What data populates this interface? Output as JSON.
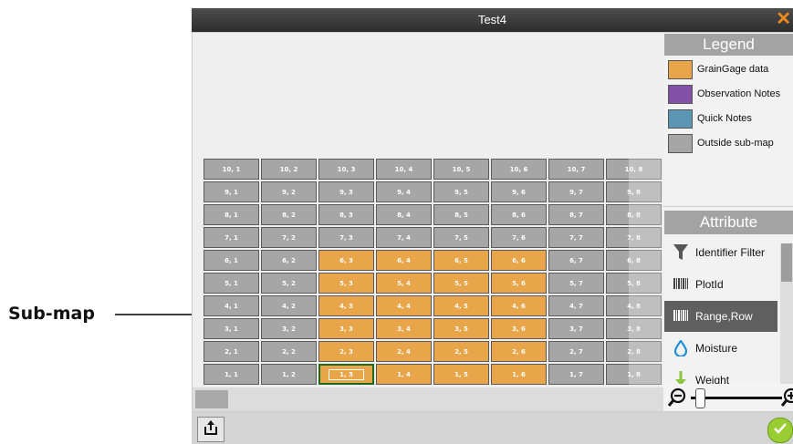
{
  "annotation": {
    "label": "Sub-map"
  },
  "window": {
    "title": "Test4",
    "close_glyph": "✕"
  },
  "legend": {
    "title": "Legend",
    "items": [
      {
        "label": "GrainGage data",
        "color": "#e8a54a"
      },
      {
        "label": "Observation Notes",
        "color": "#8352a8"
      },
      {
        "label": "Quick Notes",
        "color": "#5b96b4"
      },
      {
        "label": "Outside sub-map",
        "color": "#a6a6a6"
      }
    ]
  },
  "attribute": {
    "title": "Attribute",
    "items": [
      {
        "label": "Identifier Filter",
        "icon": "filter-icon",
        "active": false
      },
      {
        "label": "PlotId",
        "icon": "barcode-icon",
        "active": false
      },
      {
        "label": "Range,Row",
        "icon": "barcode-icon",
        "active": true
      },
      {
        "label": "Moisture",
        "icon": "water-drop-icon",
        "active": false
      },
      {
        "label": "Weight",
        "icon": "weight-down-arrow-icon",
        "active": false
      }
    ]
  },
  "grid": {
    "rows": [
      {
        "row": 10,
        "cells": [
          "10, 1",
          "10, 2",
          "10, 3",
          "10, 4",
          "10, 5",
          "10, 6",
          "10, 7",
          "10, 8"
        ],
        "orange": []
      },
      {
        "row": 9,
        "cells": [
          "9, 1",
          "9, 2",
          "9, 3",
          "9, 4",
          "9, 5",
          "9, 6",
          "9, 7",
          "9, 8"
        ],
        "orange": []
      },
      {
        "row": 8,
        "cells": [
          "8, 1",
          "8, 2",
          "8, 3",
          "8, 4",
          "8, 5",
          "8, 6",
          "8, 7",
          "8, 8"
        ],
        "orange": []
      },
      {
        "row": 7,
        "cells": [
          "7, 1",
          "7, 2",
          "7, 3",
          "7, 4",
          "7, 5",
          "7, 6",
          "7, 7",
          "7, 8"
        ],
        "orange": []
      },
      {
        "row": 6,
        "cells": [
          "6, 1",
          "6, 2",
          "6, 3",
          "6, 4",
          "6, 5",
          "6, 6",
          "6, 7",
          "6, 8"
        ],
        "orange": [
          2,
          3,
          4,
          5
        ]
      },
      {
        "row": 5,
        "cells": [
          "5, 1",
          "5, 2",
          "5, 3",
          "5, 4",
          "5, 5",
          "5, 6",
          "5, 7",
          "5, 8"
        ],
        "orange": [
          2,
          3,
          4,
          5
        ]
      },
      {
        "row": 4,
        "cells": [
          "4, 1",
          "4, 2",
          "4, 3",
          "4, 4",
          "4, 5",
          "4, 6",
          "4, 7",
          "4, 8"
        ],
        "orange": [
          2,
          3,
          4,
          5
        ]
      },
      {
        "row": 3,
        "cells": [
          "3, 1",
          "3, 2",
          "3, 3",
          "3, 4",
          "3, 5",
          "3, 6",
          "3, 7",
          "3, 8"
        ],
        "orange": [
          2,
          3,
          4,
          5
        ]
      },
      {
        "row": 2,
        "cells": [
          "2, 1",
          "2, 2",
          "2, 3",
          "2, 4",
          "2, 5",
          "2, 6",
          "2, 7",
          "2, 8"
        ],
        "orange": [
          2,
          3,
          4,
          5
        ]
      },
      {
        "row": 1,
        "cells": [
          "1, 1",
          "1, 2",
          "1, 3",
          "1, 4",
          "1, 5",
          "1, 6",
          "1, 7",
          "1, 8"
        ],
        "orange": [
          2,
          3,
          4,
          5
        ]
      }
    ],
    "selected": "1, 3",
    "colors": {
      "inside": "#e8a54a",
      "outside": "#a6a6a6",
      "selected_border": "#1c6b1c"
    }
  },
  "bottombar": {
    "share_icon": "share-icon",
    "ok_icon": "checkmark-icon"
  },
  "zoom": {
    "out_icon": "zoom-out-icon",
    "in_icon": "zoom-in-icon",
    "level": 0.05
  }
}
